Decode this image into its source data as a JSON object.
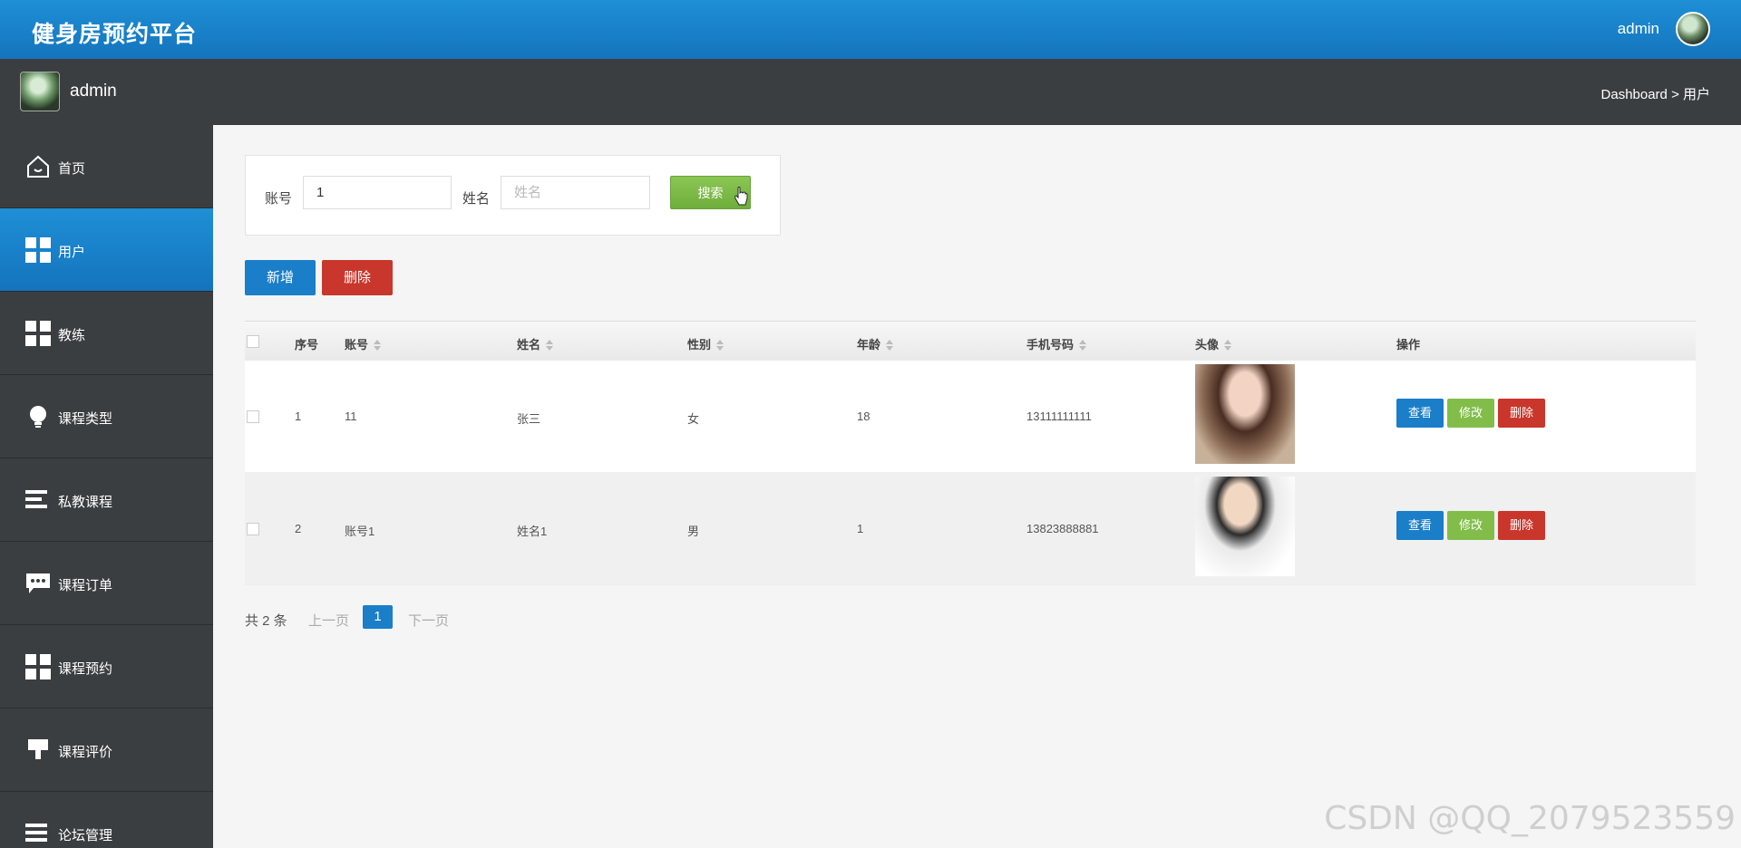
{
  "header": {
    "title": "健身房预约平台",
    "user": "admin"
  },
  "subbar": {
    "name": "admin",
    "breadcrumb": "Dashboard > 用户"
  },
  "sidebar": {
    "items": [
      {
        "label": "首页",
        "icon": "home-icon"
      },
      {
        "label": "用户",
        "icon": "grid-icon",
        "active": true
      },
      {
        "label": "教练",
        "icon": "grid-icon"
      },
      {
        "label": "课程类型",
        "icon": "lightbulb-icon"
      },
      {
        "label": "私教课程",
        "icon": "list-icon"
      },
      {
        "label": "课程订单",
        "icon": "chat-icon"
      },
      {
        "label": "课程预约",
        "icon": "grid-icon"
      },
      {
        "label": "课程评价",
        "icon": "brush-icon"
      },
      {
        "label": "论坛管理",
        "icon": "menu-icon"
      }
    ]
  },
  "search": {
    "account_label": "账号",
    "account_value": "1",
    "name_label": "姓名",
    "name_placeholder": "姓名",
    "button": "搜索"
  },
  "actions": {
    "add": "新增",
    "delete": "删除"
  },
  "table": {
    "headers": [
      "序号",
      "账号",
      "姓名",
      "性别",
      "年龄",
      "手机号码",
      "头像",
      "操作"
    ],
    "rows": [
      {
        "index": "1",
        "account": "11",
        "name": "张三",
        "gender": "女",
        "age": "18",
        "phone": "13111111111"
      },
      {
        "index": "2",
        "account": "账号1",
        "name": "姓名1",
        "gender": "男",
        "age": "1",
        "phone": "13823888881"
      }
    ],
    "row_actions": {
      "view": "查看",
      "edit": "修改",
      "delete": "删除"
    }
  },
  "pager": {
    "total": "共 2 条",
    "prev": "上一页",
    "current": "1",
    "next": "下一页"
  },
  "watermark": "CSDN @QQ_2079523559",
  "colors": {
    "primary": "#1a7ec8",
    "success": "#82bd4a",
    "danger": "#c9362b",
    "sidebar": "#3b3e41"
  }
}
